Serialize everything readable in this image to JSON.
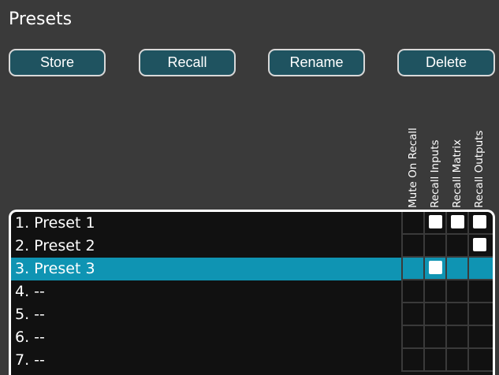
{
  "header": {
    "title": "Presets"
  },
  "toolbar": {
    "store_label": "Store",
    "recall_label": "Recall",
    "rename_label": "Rename",
    "delete_label": "Delete"
  },
  "columns": [
    "Mute On Recall",
    "Recall Inputs",
    "Recall Matrix",
    "Recall Outputs"
  ],
  "presets": [
    {
      "label": "1. Preset 1",
      "selected": false,
      "flags": [
        false,
        true,
        true,
        true
      ]
    },
    {
      "label": "2. Preset 2",
      "selected": false,
      "flags": [
        false,
        false,
        false,
        true
      ]
    },
    {
      "label": "3. Preset 3",
      "selected": true,
      "flags": [
        false,
        true,
        false,
        false
      ]
    },
    {
      "label": "4. --",
      "selected": false,
      "flags": [
        false,
        false,
        false,
        false
      ]
    },
    {
      "label": "5. --",
      "selected": false,
      "flags": [
        false,
        false,
        false,
        false
      ]
    },
    {
      "label": "6. --",
      "selected": false,
      "flags": [
        false,
        false,
        false,
        false
      ]
    },
    {
      "label": "7. --",
      "selected": false,
      "flags": [
        false,
        false,
        false,
        false
      ]
    }
  ],
  "colors": {
    "background": "#3a3a3a",
    "button": "#1f5360",
    "selected_row": "#0f94b3",
    "list_bg": "#111111"
  }
}
